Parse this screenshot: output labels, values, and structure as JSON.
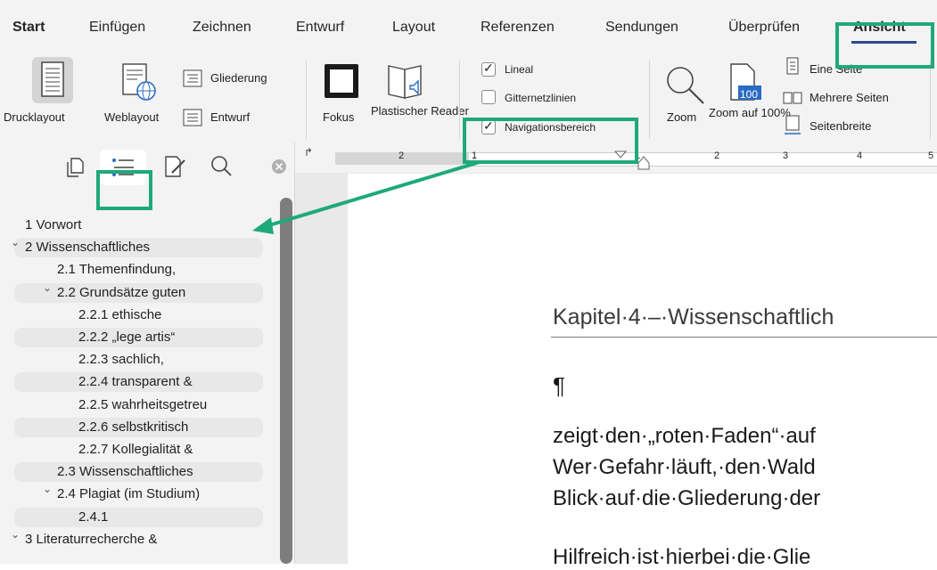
{
  "ribbon": {
    "tabs": [
      "Start",
      "Einfügen",
      "Zeichnen",
      "Entwurf",
      "Layout",
      "Referenzen",
      "Sendungen",
      "Überprüfen",
      "Ansicht"
    ],
    "views": {
      "drucklayout": "Drucklayout",
      "weblayout": "Weblayout",
      "gliederung": "Gliederung",
      "entwurf": "Entwurf"
    },
    "immersive": {
      "fokus": "Fokus",
      "reader": "Plastischer Reader"
    },
    "show": {
      "lineal": "Lineal",
      "gitter": "Gitternetzlinien",
      "navigation": "Navigationsbereich",
      "lineal_checked": true,
      "gitter_checked": false,
      "navigation_checked": true
    },
    "zoom": {
      "zoom": "Zoom",
      "zoom100": "Zoom auf 100%",
      "zoom100_icon_value": "100",
      "eine_seite": "Eine Seite",
      "mehrere_seiten": "Mehrere Seiten",
      "seitenbreite": "Seitenbreite"
    }
  },
  "ruler": {
    "ticks": [
      "2",
      "1",
      "1",
      "2",
      "3",
      "4",
      "5"
    ]
  },
  "navpane": {
    "toolbar_icons": [
      "thumbnails-icon",
      "outline-icon",
      "edit-icon",
      "search-icon",
      "close-icon"
    ],
    "items": [
      {
        "text": "1 Vorwort",
        "level": 0,
        "chevron": false
      },
      {
        "text": "2 Wissenschaftliches",
        "level": 0,
        "chevron": true
      },
      {
        "text": "2.1 Themenfindung,",
        "level": 1,
        "chevron": false
      },
      {
        "text": "2.2 Grundsätze guten",
        "level": 1,
        "chevron": true
      },
      {
        "text": "2.2.1 ethische",
        "level": 2,
        "chevron": false
      },
      {
        "text": "2.2.2 „lege artis“",
        "level": 2,
        "chevron": false
      },
      {
        "text": "2.2.3 sachlich,",
        "level": 2,
        "chevron": false
      },
      {
        "text": "2.2.4 transparent &",
        "level": 2,
        "chevron": false
      },
      {
        "text": "2.2.5 wahrheitsgetreu",
        "level": 2,
        "chevron": false
      },
      {
        "text": "2.2.6 selbstkritisch",
        "level": 2,
        "chevron": false
      },
      {
        "text": "2.2.7 Kollegialität &",
        "level": 2,
        "chevron": false
      },
      {
        "text": "2.3 Wissenschaftliches",
        "level": 1,
        "chevron": false
      },
      {
        "text": "2.4 Plagiat (im Studium)",
        "level": 1,
        "chevron": true
      },
      {
        "text": "2.4.1",
        "level": 2,
        "chevron": false
      },
      {
        "text": "3 Literaturrecherche &",
        "level": 0,
        "chevron": true
      }
    ]
  },
  "document": {
    "heading": "Kapitel·4·–·Wissenschaftlich",
    "pilcrow": "¶",
    "lines": [
      "zeigt·den·„roten·Faden“·auf",
      "Wer·Gefahr·läuft,·den·Wald",
      "Blick·auf·die·Gliederung·der",
      "Hilfreich·ist·hierbei·die·Glie"
    ]
  },
  "colors": {
    "highlight_green": "#1fa97a",
    "active_tab_underline": "#2b4a8a"
  }
}
